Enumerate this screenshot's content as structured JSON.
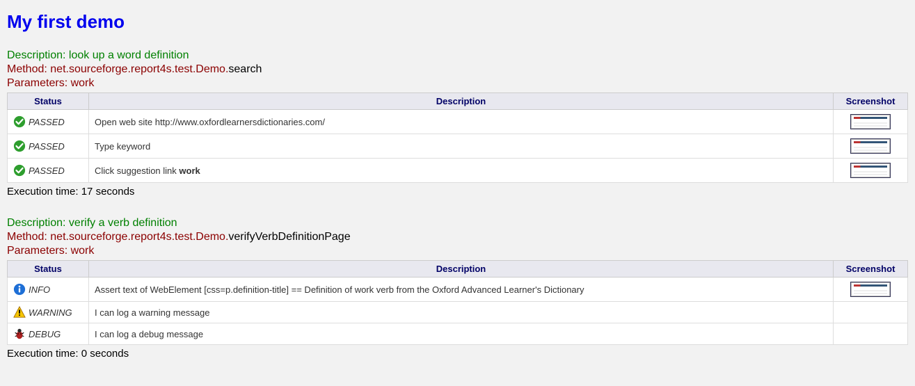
{
  "title": "My first demo",
  "table_headers": {
    "status": "Status",
    "description": "Description",
    "screenshot": "Screenshot"
  },
  "sections": [
    {
      "description_label": "Description: ",
      "description_value": "look up a word definition",
      "method_label": "Method: ",
      "method_package": "net.sourceforge.report4s.test.Demo.",
      "method_name": "search",
      "parameters_label": "Parameters: ",
      "parameters_value": "work",
      "rows": [
        {
          "status_icon": "passed",
          "status_label": "PASSED",
          "description": "Open web site http://www.oxfordlearnersdictionaries.com/",
          "has_screenshot": true
        },
        {
          "status_icon": "passed",
          "status_label": "PASSED",
          "description": "Type keyword",
          "has_screenshot": true
        },
        {
          "status_icon": "passed",
          "status_label": "PASSED",
          "description_pre": "Click suggestion link ",
          "description_bold": "work",
          "has_screenshot": true
        }
      ],
      "execution_time_label": "Execution time: ",
      "execution_time_value": "17 seconds"
    },
    {
      "description_label": "Description: ",
      "description_value": "verify a verb definition",
      "method_label": "Method: ",
      "method_package": "net.sourceforge.report4s.test.Demo.",
      "method_name": "verifyVerbDefinitionPage",
      "parameters_label": "Parameters: ",
      "parameters_value": "work",
      "rows": [
        {
          "status_icon": "info",
          "status_label": "INFO",
          "description": "Assert text of WebElement [css=p.definition-title] == Definition of work verb from the Oxford Advanced Learner's Dictionary",
          "has_screenshot": true
        },
        {
          "status_icon": "warning",
          "status_label": "WARNING",
          "description": "I can log a warning message",
          "has_screenshot": false
        },
        {
          "status_icon": "debug",
          "status_label": "DEBUG",
          "description": "I can log a debug message",
          "has_screenshot": false
        }
      ],
      "execution_time_label": "Execution time: ",
      "execution_time_value": "0 seconds"
    }
  ]
}
